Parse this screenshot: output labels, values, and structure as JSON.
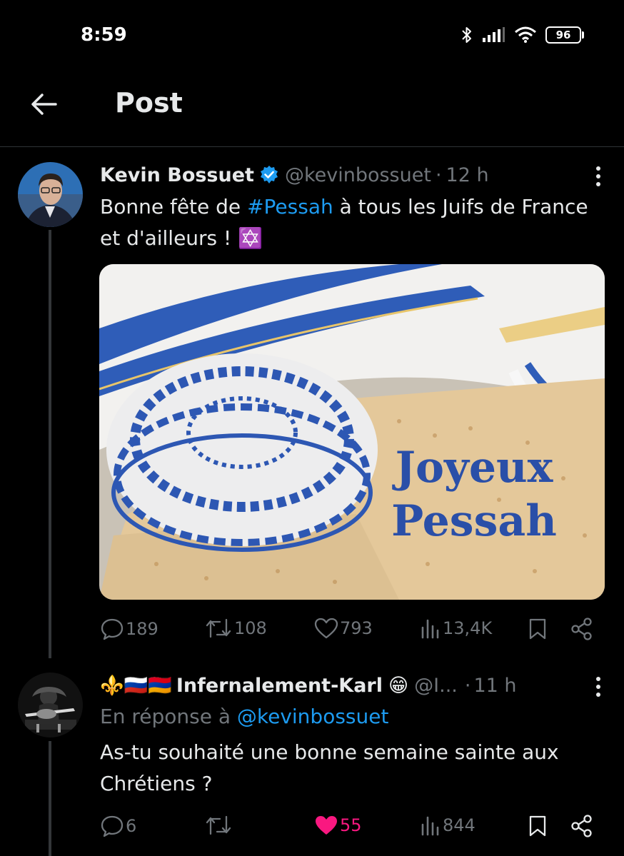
{
  "status_bar": {
    "time": "8:59",
    "battery": "96"
  },
  "header": {
    "title": "Post"
  },
  "posts": [
    {
      "author_name": "Kevin Bossuet",
      "handle": "@kevinbossuet",
      "separator": "·",
      "time_ago": "12 h",
      "text_before_hashtag": "Bonne fête de ",
      "hashtag": "#Pessah",
      "text_after_hashtag": " à tous les Juifs de France et d'ailleurs ! ",
      "emoji": "✡️",
      "image_caption_line1": "Joyeux",
      "image_caption_line2": "Pessah",
      "replies": "189",
      "reposts": "108",
      "likes": "793",
      "views": "13,4K"
    },
    {
      "author_flags": "⚜️🇷🇺🇦🇲",
      "author_name": "Infernalement-Karl",
      "author_emoji": "😁",
      "handle": "@I...",
      "separator": "·",
      "time_ago": "11 h",
      "reply_prefix": "En réponse à ",
      "reply_handle": "@kevinbossuet",
      "text": "As-tu souhaité une bonne semaine sainte aux Chrétiens ?",
      "replies": "6",
      "reposts": "",
      "likes": "55",
      "views": "844"
    }
  ],
  "colors": {
    "background": "#000000",
    "accent": "#1d9bf0",
    "muted": "#71767b",
    "like": "#f91880",
    "text": "#e7e9ea"
  }
}
